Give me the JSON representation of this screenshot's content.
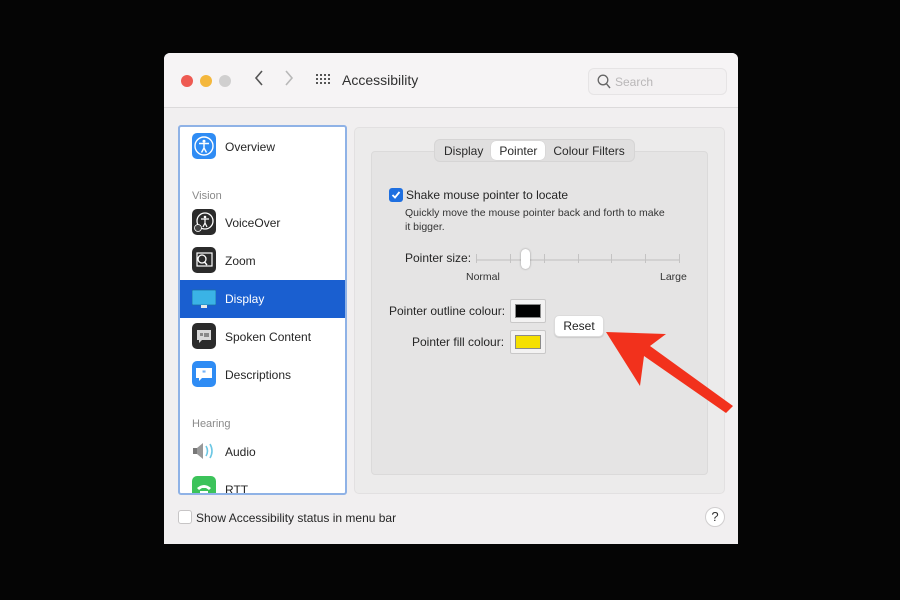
{
  "window": {
    "title": "Accessibility",
    "search_placeholder": "Search",
    "search_value": ""
  },
  "sidebar": {
    "sections": [
      {
        "label": "Vision"
      },
      {
        "label": "Hearing"
      }
    ],
    "items": [
      {
        "label": "Overview",
        "icon": "accessibility-icon"
      },
      {
        "label": "VoiceOver",
        "icon": "voiceover-icon"
      },
      {
        "label": "Zoom",
        "icon": "zoom-icon"
      },
      {
        "label": "Display",
        "icon": "display-icon",
        "selected": true
      },
      {
        "label": "Spoken Content",
        "icon": "spoken-content-icon"
      },
      {
        "label": "Descriptions",
        "icon": "descriptions-icon"
      },
      {
        "label": "Audio",
        "icon": "speaker-icon"
      },
      {
        "label": "RTT",
        "icon": "rtt-phone-icon"
      }
    ]
  },
  "tabs": [
    {
      "label": "Display"
    },
    {
      "label": "Pointer",
      "active": true
    },
    {
      "label": "Colour Filters"
    }
  ],
  "pointer": {
    "shake_label": "Shake mouse pointer to locate",
    "shake_checked": true,
    "shake_description": "Quickly move the mouse pointer back and forth to make it bigger.",
    "shake_description_line1": "Quickly move the mouse pointer back and forth to make",
    "shake_description_line2": "it bigger.",
    "size_label": "Pointer size:",
    "size_min_label": "Normal",
    "size_max_label": "Large",
    "size_value_fraction": 0.24,
    "size_tick_count": 7,
    "outline_label": "Pointer outline colour:",
    "outline_color": "#000000",
    "fill_label": "Pointer fill colour:",
    "fill_color": "#f5e000",
    "reset_label": "Reset"
  },
  "footer": {
    "status_label": "Show Accessibility status in menu bar",
    "status_checked": false,
    "help_label": "?"
  },
  "annotation": {
    "arrow_color": "#f2311c",
    "points_to": "reset-button"
  },
  "colors": {
    "accent": "#1a5fd0",
    "checkbox": "#1e6fe0"
  }
}
